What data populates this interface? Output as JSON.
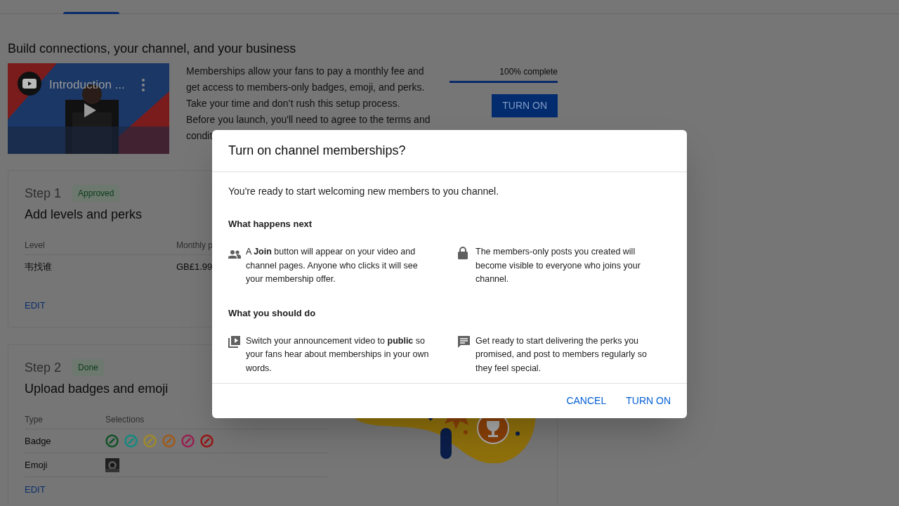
{
  "intro": {
    "heading": "Build connections, your channel, and your business",
    "video": {
      "title": "Introduction ...",
      "kind": "picture"
    },
    "description_lines": [
      "Memberships allow your fans to pay a monthly fee and",
      "get access to members-only badges, emoji, and perks.",
      "Take your time and don’t rush this setup process.",
      "Before you launch, you'll need to agree to the terms and",
      "condit"
    ],
    "progress": {
      "label": "100% complete",
      "level": 1
    },
    "button": "TURN ON"
  },
  "steps": [
    {
      "step": "Step 1",
      "status": "Approved",
      "title": "Add levels and perks",
      "columns": [
        "Level",
        "Monthly p"
      ],
      "rows": [
        {
          "kind": "text",
          "cells": [
            "韦找谁",
            "GB£1.99"
          ]
        }
      ],
      "edit": "EDIT"
    },
    {
      "step": "Step 2",
      "status": "Done",
      "title": "Upload badges and emoji",
      "columns": [
        "Type",
        "Selections"
      ],
      "rows": [
        {
          "kind": "badges",
          "label": "Badge",
          "badges": [
            {
              "color": "#13522a"
            },
            {
              "color": "#138a80"
            },
            {
              "color": "#a08a2a"
            },
            {
              "color": "#a05a1a"
            },
            {
              "color": "#9a2050"
            },
            {
              "color": "#9a1515"
            }
          ]
        },
        {
          "kind": "picture",
          "label": "Emoji"
        }
      ],
      "edit": "EDIT"
    }
  ],
  "dialog": {
    "title": "Turn on channel memberships?",
    "intro": "You're ready to start welcoming new members to you channel.",
    "sections": [
      {
        "heading": "What happens next",
        "items": [
          {
            "text": "A **Join** button will appear on your video and channel pages. Anyone who clicks it will see your membership offer."
          },
          {
            "text": "The members-only posts you created will become visible to everyone who joins your channel."
          }
        ]
      },
      {
        "heading": "What you should do",
        "items": [
          {
            "text": "Switch your announcement video to **public** so your fans hear about memberships in your own words."
          },
          {
            "text": "Get ready to start delivering the perks you promised, and post to members regularly so they feel special."
          }
        ]
      }
    ],
    "buttons": [
      "CANCEL",
      "TURN ON"
    ]
  }
}
